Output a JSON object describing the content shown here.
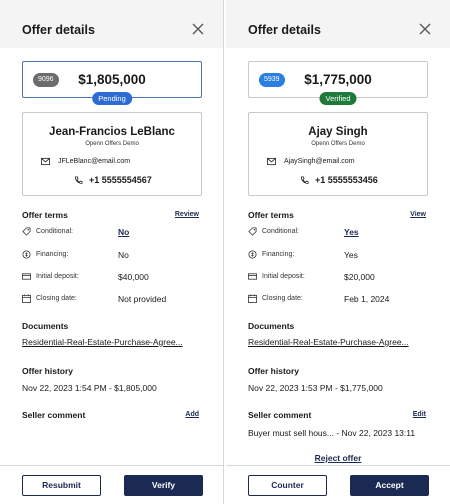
{
  "left": {
    "title": "Offer details",
    "id_tag": "9096",
    "price": "$1,805,000",
    "status": "Pending",
    "buyer_name": "Jean-Francios LeBlanc",
    "org": "Openn Offers Demo",
    "email": "JFLeBlanc@email.com",
    "phone": "+1 5555554567",
    "terms_title": "Offer terms",
    "terms_link": "Review",
    "terms": [
      {
        "label": "Conditional:",
        "value": "No"
      },
      {
        "label": "Financing:",
        "value": "No"
      },
      {
        "label": "Initial deposit:",
        "value": "$40,000"
      },
      {
        "label": "Closing date:",
        "value": "Not provided"
      }
    ],
    "documents_title": "Documents",
    "document": "Residential-Real-Estate-Purchase-Agree...",
    "history_title": "Offer history",
    "history": "Nov 22, 2023 1:54 PM - $1,805,000",
    "comment_title": "Seller comment",
    "comment_link": "Add",
    "btn_secondary": "Resubmit",
    "btn_primary": "Verify"
  },
  "right": {
    "title": "Offer details",
    "id_tag": "5939",
    "price": "$1,775,000",
    "status": "Verified",
    "buyer_name": "Ajay Singh",
    "org": "Openn Offers Demo",
    "email": "AjaySingh@email.com",
    "phone": "+1 5555553456",
    "terms_title": "Offer terms",
    "terms_link": "View",
    "terms": [
      {
        "label": "Conditional:",
        "value": "Yes"
      },
      {
        "label": "Financing:",
        "value": "Yes"
      },
      {
        "label": "Initial deposit:",
        "value": "$20,000"
      },
      {
        "label": "Closing date:",
        "value": "Feb 1, 2024"
      }
    ],
    "documents_title": "Documents",
    "document": "Residential-Real-Estate-Purchase-Agree...",
    "history_title": "Offer history",
    "history": "Nov 22, 2023 1:53 PM - $1,775,000",
    "comment_title": "Seller comment",
    "comment_link": "Edit",
    "comment": "Buyer must sell hous... - Nov 22, 2023 13:11",
    "reject": "Reject offer",
    "btn_secondary": "Counter",
    "btn_primary": "Accept"
  },
  "colors": {
    "navy": "#1a2a52",
    "pending": "#2c6bd1",
    "verified": "#1d7a3a",
    "id_gray": "#6c6c6c",
    "id_blue": "#2b7de0",
    "header_bg": "#f4f4f5"
  },
  "icons": [
    "close-icon",
    "mail-icon",
    "phone-icon",
    "conditional-icon",
    "financing-icon",
    "deposit-icon",
    "calendar-icon"
  ]
}
